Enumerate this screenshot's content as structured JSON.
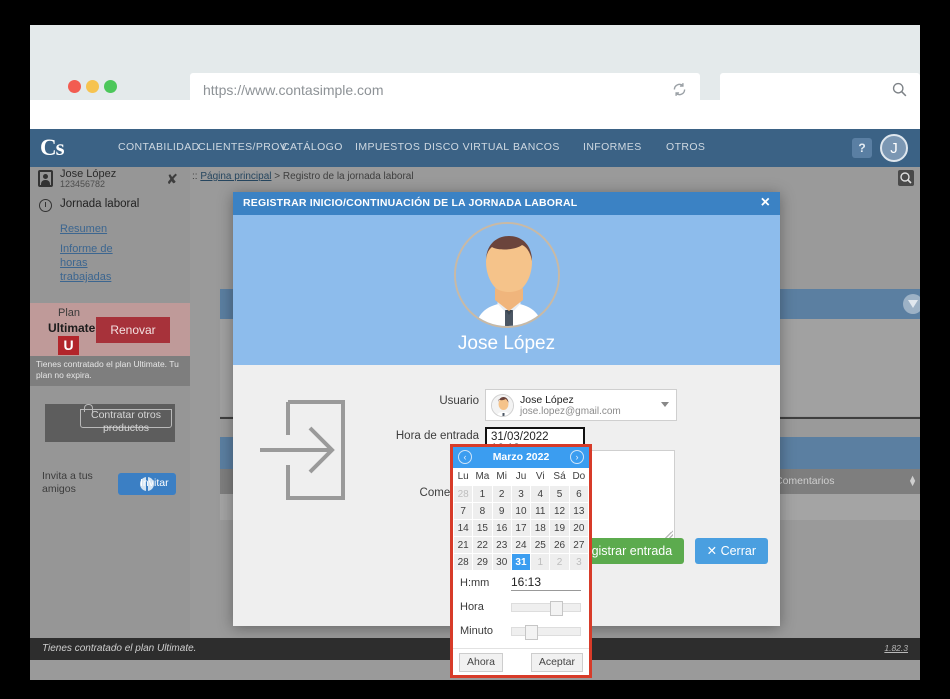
{
  "browser": {
    "url": "https://www.contasimple.com",
    "search_placeholder": "",
    "reload_icon": "reload-icon",
    "search_icon": "search-icon"
  },
  "topnav": {
    "logo": "Cs",
    "items": [
      "CONTABILIDAD",
      "CLIENTES/PROV.",
      "CATÁLOGO",
      "IMPUESTOS",
      "DISCO VIRTUAL",
      "BANCOS",
      "INFORMES",
      "OTROS"
    ],
    "help": "?",
    "avatar_initial": "J"
  },
  "breadcrumb": {
    "prefix": ":: ",
    "home": "Página principal",
    "separator": " > ",
    "current": "Registro de la jornada laboral"
  },
  "sidebar": {
    "user_name": "Jose López",
    "user_nif": "123456782",
    "collapse_icon": "collapse-icon",
    "section": "Jornada laboral",
    "links": [
      "Resumen",
      "Informe de horas trabajadas"
    ],
    "plan_label": "Plan",
    "plan_name": "Ultimate",
    "plan_badge": "U",
    "renew_button": "Renovar",
    "plan_note": "Tienes contratado el plan Ultimate. Tu plan no expira.",
    "other_products_button": "Contratar otros productos",
    "invite_label": "Invita a tus amigos",
    "invite_button": "Invitar"
  },
  "background_page": {
    "table_header_label": "Comentarios"
  },
  "modal": {
    "title": "REGISTRAR INICIO/CONTINUACIÓN DE LA JORNADA LABORAL",
    "close_icon": "×",
    "hero_name": "Jose López",
    "labels": {
      "usuario": "Usuario",
      "hora_entrada": "Hora de entrada",
      "comentario": "Comentario"
    },
    "user_select": {
      "name": "Jose López",
      "email": "jose.lopez@gmail.com"
    },
    "hora_entrada_value": "31/03/2022 16:13",
    "comentario_value": "",
    "buttons": {
      "submit": "Registrar entrada",
      "close": "✕ Cerrar"
    }
  },
  "datepicker": {
    "prev_icon": "‹",
    "next_icon": "›",
    "month_title": "Marzo 2022",
    "weekdays": [
      "Lu",
      "Ma",
      "Mi",
      "Ju",
      "Vi",
      "Sá",
      "Do"
    ],
    "weeks": [
      [
        {
          "d": "28",
          "off": true
        },
        {
          "d": "1"
        },
        {
          "d": "2"
        },
        {
          "d": "3"
        },
        {
          "d": "4"
        },
        {
          "d": "5"
        },
        {
          "d": "6"
        }
      ],
      [
        {
          "d": "7"
        },
        {
          "d": "8"
        },
        {
          "d": "9"
        },
        {
          "d": "10"
        },
        {
          "d": "11"
        },
        {
          "d": "12"
        },
        {
          "d": "13"
        }
      ],
      [
        {
          "d": "14"
        },
        {
          "d": "15"
        },
        {
          "d": "16"
        },
        {
          "d": "17"
        },
        {
          "d": "18"
        },
        {
          "d": "19"
        },
        {
          "d": "20"
        }
      ],
      [
        {
          "d": "21"
        },
        {
          "d": "22"
        },
        {
          "d": "23"
        },
        {
          "d": "24"
        },
        {
          "d": "25"
        },
        {
          "d": "26"
        },
        {
          "d": "27"
        }
      ],
      [
        {
          "d": "28"
        },
        {
          "d": "29"
        },
        {
          "d": "30"
        },
        {
          "d": "31",
          "sel": true
        },
        {
          "d": "1",
          "off": true
        },
        {
          "d": "2",
          "off": true
        },
        {
          "d": "3",
          "off": true
        }
      ]
    ],
    "time_label": "H:mm",
    "time_value": "16:13",
    "hour_label": "Hora",
    "minute_label": "Minuto",
    "hour_pct": 67,
    "minute_pct": 22,
    "now_button": "Ahora",
    "accept_button": "Aceptar",
    "highlight_color": "#d73b29"
  },
  "footer": {
    "left": "Tienes contratado el plan Ultimate.",
    "version": "1.82.3"
  }
}
